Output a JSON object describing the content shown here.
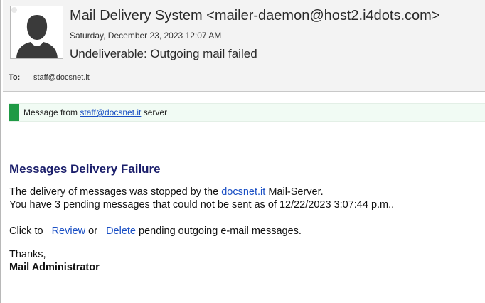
{
  "header": {
    "sender": "Mail Delivery System <mailer-daemon@host2.i4dots.com>",
    "date": "Saturday, December 23, 2023 12:07 AM",
    "subject": "Undeliverable: Outgoing mail failed",
    "to_label": "To:",
    "to_value": "staff@docsnet.it",
    "avatar_icon": "person-silhouette-icon"
  },
  "banner": {
    "prefix": "Message from ",
    "link": "staff@docsnet.it",
    "suffix": " server",
    "accent_color": "#1f9a45"
  },
  "message": {
    "title": "Messages Delivery Failure",
    "line1_prefix": "The delivery of messages was stopped by the ",
    "line1_link": "docsnet.it",
    "line1_suffix": "  Mail-Server.",
    "line2": "You have 3 pending messages that could not be sent as of 12/22/2023 3:07:44 p.m..",
    "click_prefix": "Click to ",
    "review": "Review",
    "or": " or ",
    "delete": "Delete",
    "click_suffix": " pending outgoing e-mail messages.",
    "thanks": "Thanks,",
    "signature": "Mail Administrator"
  },
  "colors": {
    "title": "#1b1f6b",
    "link": "#1a4fc4",
    "header_bg": "#f3f3f3"
  }
}
